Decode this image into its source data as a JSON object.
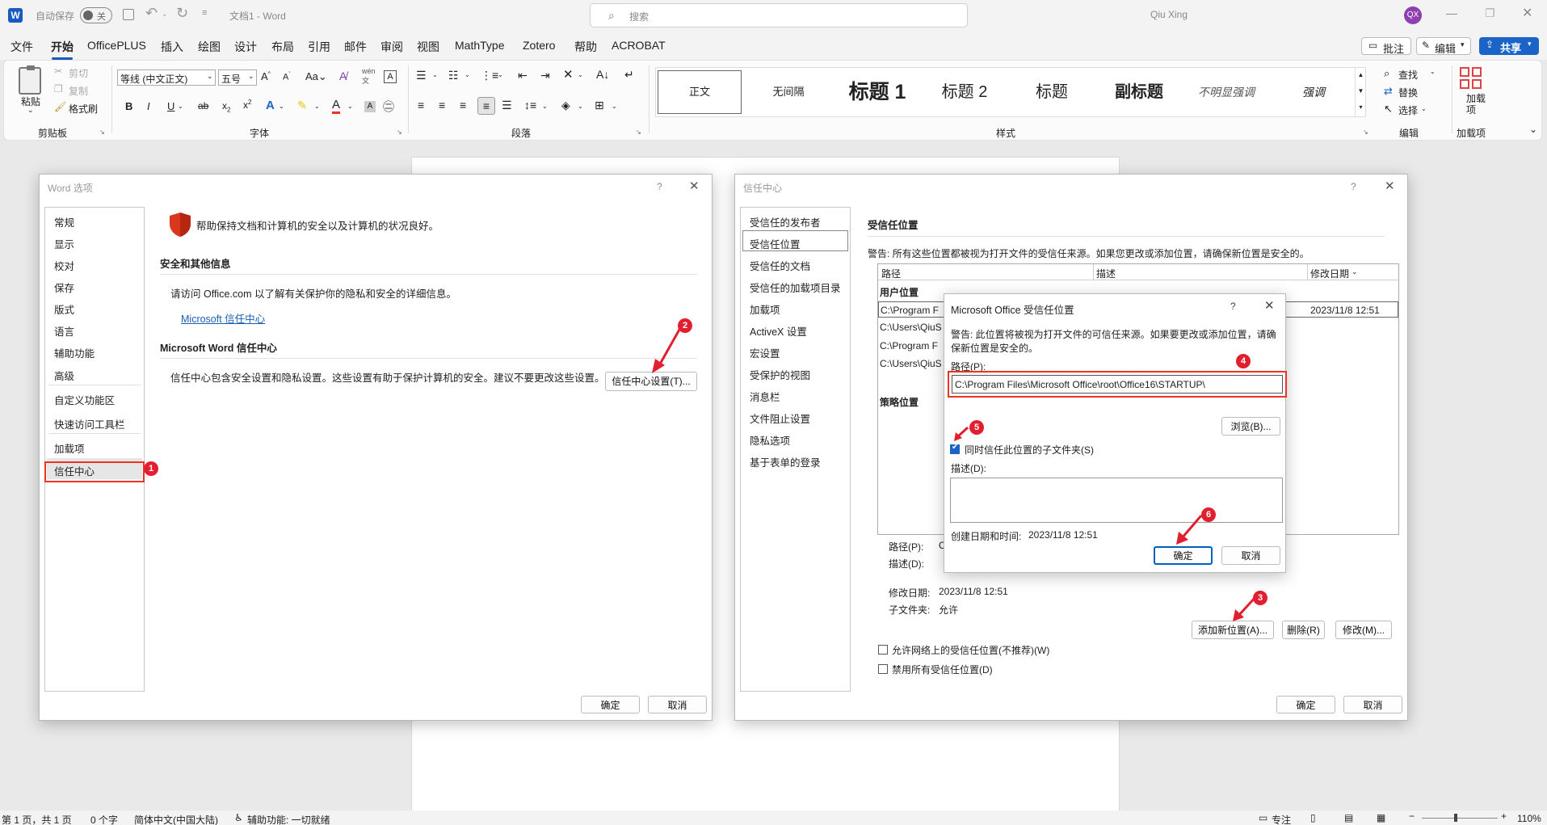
{
  "titlebar": {
    "autosave_label": "自动保存",
    "autosave_state": "关",
    "doc_title": "文档1 - Word",
    "search_placeholder": "搜索",
    "user_name": "Qiu Xing",
    "user_initials": "QX"
  },
  "menu": {
    "tabs": [
      "文件",
      "开始",
      "OfficePLUS",
      "插入",
      "绘图",
      "设计",
      "布局",
      "引用",
      "邮件",
      "审阅",
      "视图",
      "MathType",
      "Zotero",
      "帮助",
      "ACROBAT"
    ],
    "active_tab": "开始",
    "comment_btn": "批注",
    "edit_btn": "编辑",
    "share_btn": "共享"
  },
  "ribbon": {
    "clipboard": {
      "paste": "粘贴",
      "cut": "剪切",
      "copy": "复制",
      "format_painter": "格式刷",
      "group_label": "剪贴板"
    },
    "font": {
      "font_name": "等线 (中文正文)",
      "font_size": "五号",
      "group_label": "字体"
    },
    "paragraph": {
      "group_label": "段落"
    },
    "styles": {
      "items": [
        "正文",
        "无间隔",
        "标题 1",
        "标题 2",
        "标题",
        "副标题",
        "不明显强调",
        "强调"
      ],
      "group_label": "样式"
    },
    "editing": {
      "find": "查找",
      "replace": "替换",
      "select": "选择",
      "group_label": "编辑"
    },
    "addins": {
      "label": "加载项",
      "group_label": "加载项"
    }
  },
  "word_options": {
    "title": "Word 选项",
    "nav": [
      "常规",
      "显示",
      "校对",
      "保存",
      "版式",
      "语言",
      "辅助功能",
      "高级",
      "自定义功能区",
      "快速访问工具栏",
      "加载项",
      "信任中心"
    ],
    "selected_nav": "信任中心",
    "header_text": "帮助保持文档和计算机的安全以及计算机的状况良好。",
    "section1_title": "安全和其他信息",
    "section1_text": "请访问 Office.com 以了解有关保护你的隐私和安全的详细信息。",
    "section1_link": "Microsoft 信任中心",
    "section2_title": "Microsoft Word 信任中心",
    "section2_text": "信任中心包含安全设置和隐私设置。这些设置有助于保护计算机的安全。建议不要更改这些设置。",
    "trust_center_btn": "信任中心设置(T)...",
    "ok": "确定",
    "cancel": "取消"
  },
  "trust_center": {
    "title": "信任中心",
    "nav": [
      "受信任的发布者",
      "受信任位置",
      "受信任的文档",
      "受信任的加载项目录",
      "加载项",
      "ActiveX 设置",
      "宏设置",
      "受保护的视图",
      "消息栏",
      "文件阻止设置",
      "隐私选项",
      "基于表单的登录"
    ],
    "selected_nav": "受信任位置",
    "section_title": "受信任位置",
    "warning": "警告: 所有这些位置都被视为打开文件的受信任来源。如果您更改或添加位置，请确保新位置是安全的。",
    "columns": [
      "路径",
      "描述",
      "修改日期"
    ],
    "user_locations_label": "用户位置",
    "rows": [
      {
        "path": "C:\\Program F",
        "date": "2023/11/8 12:51"
      },
      {
        "path": "C:\\Users\\QiuS",
        "date": ""
      },
      {
        "path": "C:\\Program F",
        "date": ""
      },
      {
        "path": "C:\\Users\\QiuS",
        "date": ""
      }
    ],
    "policy_locations_label": "策略位置",
    "detail_path_label": "路径(P):",
    "detail_path_value": "C",
    "detail_desc_label": "描述(D):",
    "detail_date_label": "修改日期:",
    "detail_date_value": "2023/11/8 12:51",
    "detail_sub_label": "子文件夹:",
    "detail_sub_value": "允许",
    "add_btn": "添加新位置(A)...",
    "remove_btn": "删除(R)",
    "modify_btn": "修改(M)...",
    "allow_network": "允许网络上的受信任位置(不推荐)(W)",
    "disable_all": "禁用所有受信任位置(D)",
    "ok": "确定",
    "cancel": "取消"
  },
  "ms_dialog": {
    "title": "Microsoft Office 受信任位置",
    "warning": "警告: 此位置将被视为打开文件的可信任来源。如果要更改或添加位置，请确保新位置是安全的。",
    "path_label": "路径(P):",
    "path_value": "C:\\Program Files\\Microsoft Office\\root\\Office16\\STARTUP\\",
    "browse": "浏览(B)...",
    "subfolder_label": "同时信任此位置的子文件夹(S)",
    "subfolder_checked": true,
    "desc_label": "描述(D):",
    "created_label": "创建日期和时间:",
    "created_value": "2023/11/8 12:51",
    "ok": "确定",
    "cancel": "取消"
  },
  "badges": [
    "1",
    "2",
    "3",
    "4",
    "5",
    "6"
  ],
  "status": {
    "page": "第 1 页，共 1 页",
    "words": "0 个字",
    "lang": "简体中文(中国大陆)",
    "accessibility": "辅助功能: 一切就绪",
    "focus": "专注",
    "zoom": "110%"
  },
  "colors": {
    "accent": "#1a64c8",
    "annotation": "#e21f2f",
    "shield": "#d9381e"
  }
}
